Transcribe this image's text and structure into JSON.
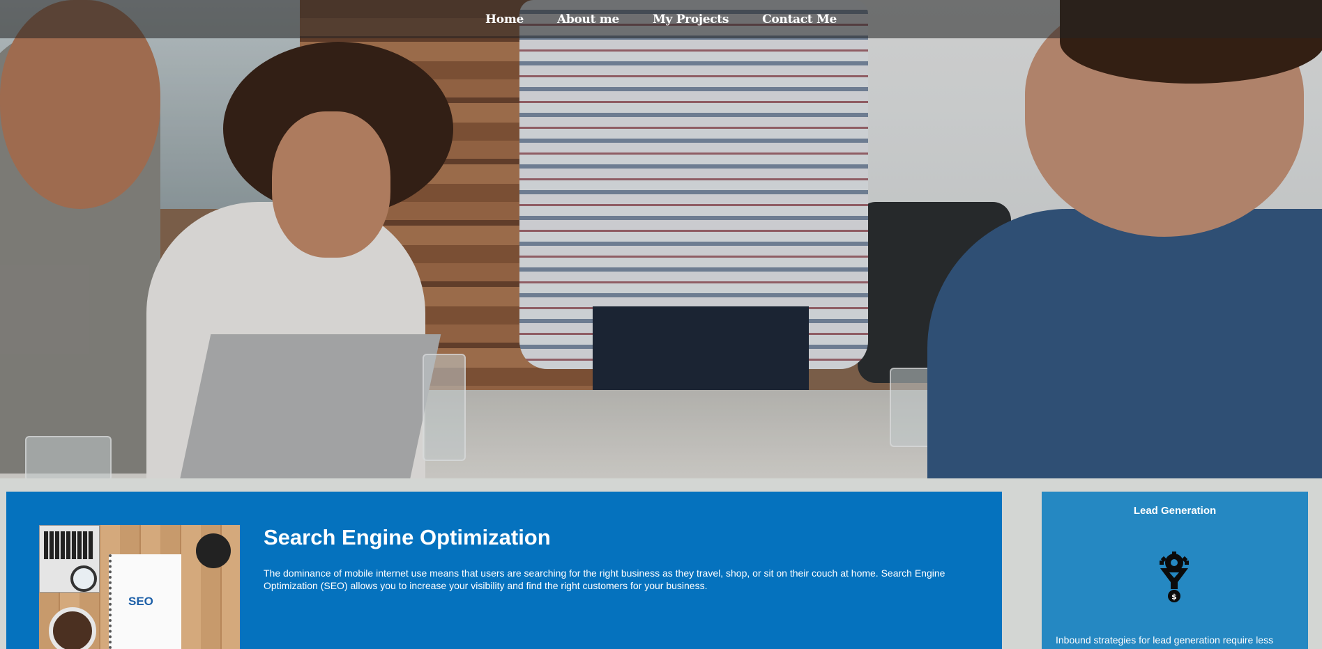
{
  "nav": {
    "items": [
      {
        "label": "Home"
      },
      {
        "label": "About me"
      },
      {
        "label": "My Projects"
      },
      {
        "label": "Contact Me"
      }
    ]
  },
  "hero": {
    "image": "team-meeting-photo"
  },
  "main_card": {
    "title": "Search Engine Optimization",
    "text": "The dominance of mobile internet use means that users are searching for the right business as they travel, shop, or sit on their couch at home. Search Engine Optimization (SEO) allows you to increase your visibility and find the right customers for your business.",
    "image_word": "SEO",
    "background_color": "#0572be"
  },
  "side_card": {
    "title": "Lead Generation",
    "icon": "funnel-gear-dollar-icon",
    "text": "Inbound strategies for lead generation require less",
    "background_color": "#2588c2"
  }
}
